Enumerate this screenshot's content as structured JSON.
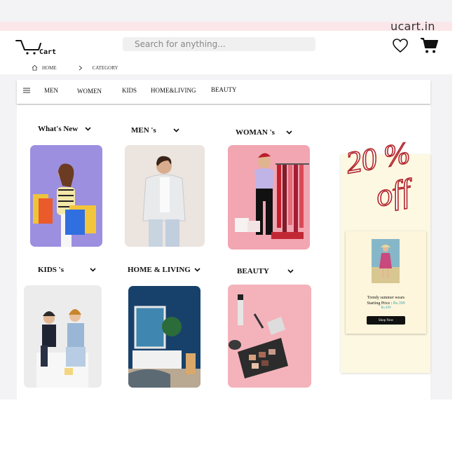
{
  "site": {
    "domain": "ucart.in",
    "logo_text": "Cart"
  },
  "search": {
    "placeholder": "Search for anything..."
  },
  "breadcrumb": {
    "home": "HOME",
    "category": "CATEGORY"
  },
  "nav": {
    "items": [
      "MEN",
      "WOMEN",
      "KIDS",
      "HOME&LIVING",
      "BEAUTY"
    ]
  },
  "categories": [
    {
      "label": "What's New"
    },
    {
      "label": "MEN 's"
    },
    {
      "label": "WOMAN 's"
    },
    {
      "label": "KIDS 's"
    },
    {
      "label": "HOME & LIVING"
    },
    {
      "label": "BEAUTY"
    }
  ],
  "promo": {
    "discount": "20 %",
    "off": "off",
    "card": {
      "title": "Trendy summer wears",
      "price_label": "Starting Price :",
      "price_new": "Rs.399",
      "price_old": "Rs.499",
      "button": "Shop Now"
    }
  },
  "colors": {
    "pink_band": "#fbe7ea",
    "promo_red": "#b3262c",
    "promo_bg": "#fdf8e2",
    "price_teal": "#3aa6b0"
  }
}
